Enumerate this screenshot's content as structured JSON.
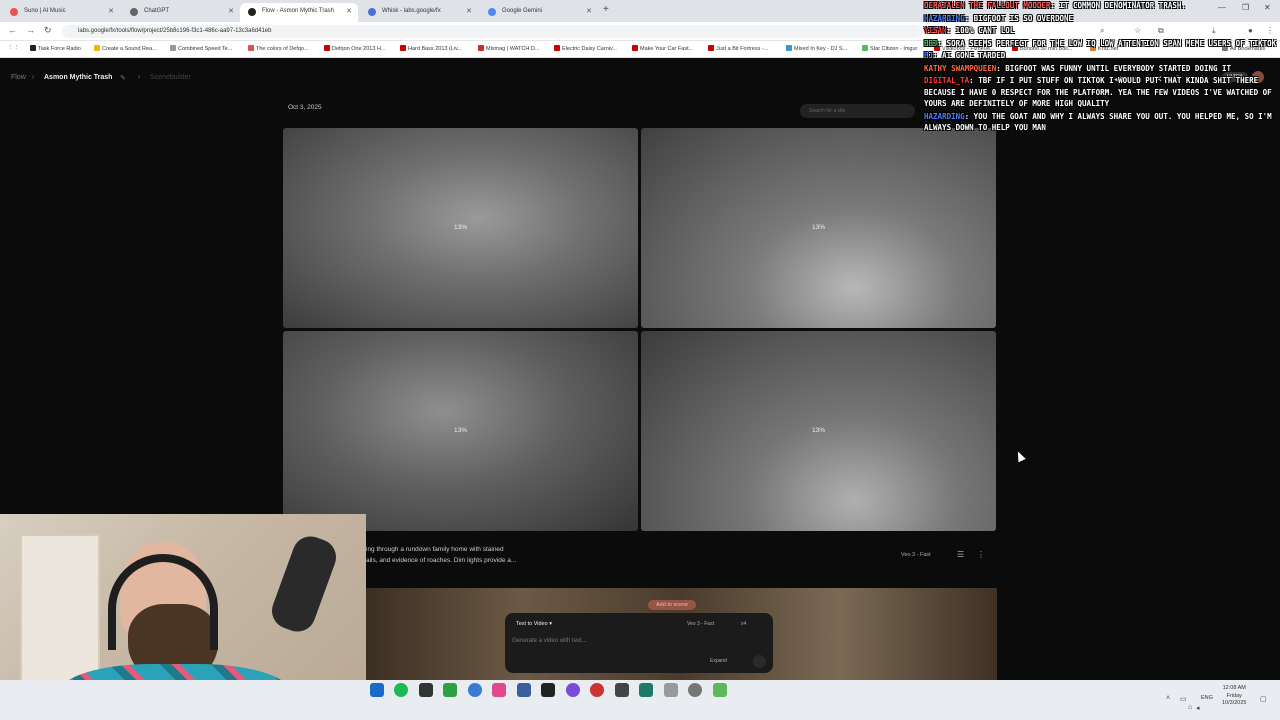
{
  "browser": {
    "tabs": [
      {
        "title": "Suno | AI Music",
        "color": "#e6564a"
      },
      {
        "title": "ChatGPT",
        "color": "#666666"
      },
      {
        "title": "Flow - Asmon Mythic Trash",
        "color": "#222222"
      },
      {
        "title": "Whisk - labs.google/fx",
        "color": "#4a6fd8"
      },
      {
        "title": "Google Gemini",
        "color": "#4a8af4"
      }
    ],
    "url": "labs.google/fx/tools/flow/project/25b8c196-f3c1-486c-aa97-13c3a6d41eb",
    "bookmarks": [
      {
        "label": "Task Force Radio",
        "color": "#222222"
      },
      {
        "label": "Create a Sound Rea...",
        "color": "#f2b705"
      },
      {
        "label": "Combined Speed Te...",
        "color": "#999999"
      },
      {
        "label": "The colors of Defqo...",
        "color": "#d9534f"
      },
      {
        "label": "Defqon One 2013 H...",
        "color": "#cc0000"
      },
      {
        "label": "Hard Bass 2013 (Liv...",
        "color": "#cc0000"
      },
      {
        "label": "Mixmag | WATCH D...",
        "color": "#c9302c"
      },
      {
        "label": "Electric Daisy Carniv...",
        "color": "#cc0000"
      },
      {
        "label": "Make Your Car Fast...",
        "color": "#cc0000"
      },
      {
        "label": "Just a Bit Fortress -...",
        "color": "#cc0000"
      },
      {
        "label": "Mixed In Key - DJ S...",
        "color": "#3399cc"
      },
      {
        "label": "Star Citizen - Imgur",
        "color": "#5bb85c"
      },
      {
        "label": "Villalobos - Fizheue...",
        "color": "#cc0000"
      },
      {
        "label": "Bonobo 50 min Boil...",
        "color": "#cc0000"
      },
      {
        "label": "Kritz.net",
        "color": "#e87722"
      },
      {
        "label": "All Bookmarks",
        "color": "#777777"
      }
    ]
  },
  "app": {
    "breadcrumb_root": "Flow",
    "project_title": "Asmon Mythic Trash",
    "breadcrumb_page": "Scenebuilder",
    "date": "Oct 3, 2025",
    "search_placeholder": "Search for a clip",
    "plan_badge": "ULTRA",
    "tiles": [
      {
        "progress_label": "13%"
      },
      {
        "progress_label": "13%"
      },
      {
        "progress_label": "13%"
      },
      {
        "progress_label": "13%"
      }
    ],
    "prompt_line1": "ing through a rundown family home with stained",
    "prompt_line2": "ails, and evidence of roaches. Dim lights provide a...",
    "model_label": "Veo 3 - Fast",
    "add_to_scene": "Add to scene",
    "composer": {
      "mode": "Text to Video",
      "model": "Veo 3 - Fast",
      "count": "x4",
      "placeholder": "Generate a video with text...",
      "expand": "Expand"
    }
  },
  "chat": [
    {
      "user": "Derajalen The Fallout Modder",
      "color": "#ff5a5a",
      "text": "It common denominator trash."
    },
    {
      "user": "Hazarding",
      "color": "#4a7dff",
      "text": "Bigfoot is so overdone"
    },
    {
      "user": "Yisan",
      "color": "#ff3b3b",
      "text": "100% cant lol"
    },
    {
      "user": "BBJ",
      "color": "#31c451",
      "text": "Sora seems perfect for the low iq low attention span meme users of tiktok"
    },
    {
      "user": "BJ",
      "color": "#4a7dff",
      "text": "AI gone tarded"
    },
    {
      "user": "Kathy SwampQueen",
      "color": "#ff6a3d",
      "text": "Bigfoot was funny until everybody started doing it"
    },
    {
      "user": "Digital_Ta",
      "color": "#ff3b3b",
      "text": "tbf if i put stuff on tiktok i would put that kinda shit there because i have 0 respect for the platform. yea the few videos i've watched of yours are definitely of more high quality"
    },
    {
      "user": "Hazarding",
      "color": "#4a7dff",
      "text": "You the goat and why I always share you out. You helped me, so I'm always down to help you man"
    }
  ],
  "taskbar": {
    "lang": "ENG",
    "time": "12:08 AM",
    "day": "Friday",
    "date": "10/3/2025"
  }
}
